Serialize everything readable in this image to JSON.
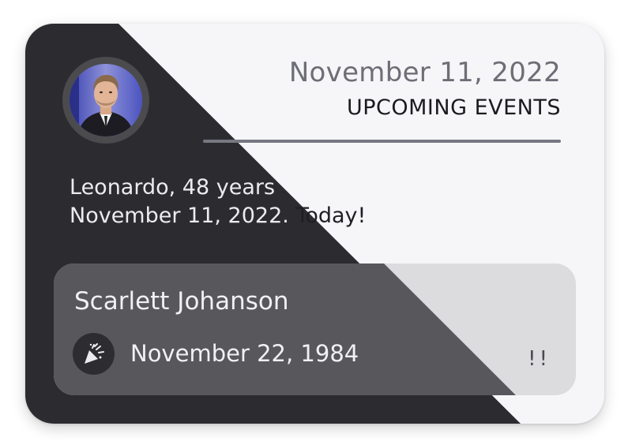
{
  "header": {
    "date": "November 11, 2022",
    "title": "UPCOMING EVENTS"
  },
  "today": {
    "line1_dark": "Leonardo, 48 years",
    "line1_light": "",
    "line2_dark": "November 11, 2022. ",
    "line2_light": "Today!"
  },
  "event": {
    "name": "Scarlett Johanson",
    "date": "November 22, 1984",
    "marker": "!!",
    "icon": "party-popper-icon"
  },
  "colors": {
    "dark_panel": "#2c2c30",
    "light_panel": "#f6f5f8",
    "event_dark": "#58585c",
    "event_light": "#dcdcdf",
    "rule": "#777882"
  }
}
